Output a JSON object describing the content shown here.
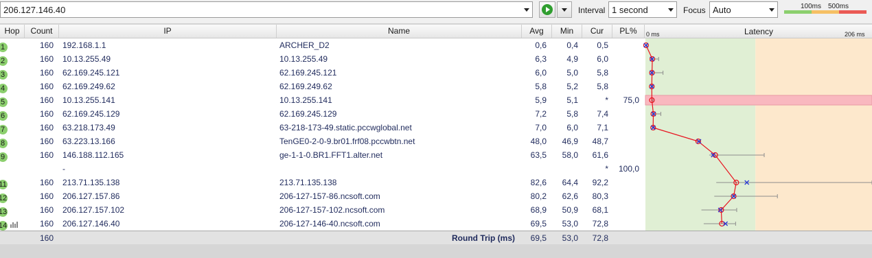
{
  "toolbar": {
    "target_value": "206.127.146.40",
    "interval_label": "Interval",
    "interval_value": "1 second",
    "focus_label": "Focus",
    "focus_value": "Auto",
    "scale_100": "100ms",
    "scale_500": "500ms"
  },
  "columns": {
    "hop": "Hop",
    "count": "Count",
    "ip": "IP",
    "name": "Name",
    "avg": "Avg",
    "min": "Min",
    "cur": "Cur",
    "pl": "PL%",
    "latency": "Latency",
    "latency_min": "0 ms",
    "latency_max": "206 ms"
  },
  "hops": [
    {
      "hop": "1",
      "count": "160",
      "ip": "192.168.1.1",
      "name": "ARCHER_D2",
      "avg": "0,6",
      "min": "0,4",
      "cur": "0,5",
      "pl": ""
    },
    {
      "hop": "2",
      "count": "160",
      "ip": "10.13.255.49",
      "name": "10.13.255.49",
      "avg": "6,3",
      "min": "4,9",
      "cur": "6,0",
      "pl": ""
    },
    {
      "hop": "3",
      "count": "160",
      "ip": "62.169.245.121",
      "name": "62.169.245.121",
      "avg": "6,0",
      "min": "5,0",
      "cur": "5,8",
      "pl": ""
    },
    {
      "hop": "4",
      "count": "160",
      "ip": "62.169.249.62",
      "name": "62.169.249.62",
      "avg": "5,8",
      "min": "5,2",
      "cur": "5,8",
      "pl": ""
    },
    {
      "hop": "5",
      "count": "160",
      "ip": "10.13.255.141",
      "name": "10.13.255.141",
      "avg": "5,9",
      "min": "5,1",
      "cur": "*",
      "pl": "75,0"
    },
    {
      "hop": "6",
      "count": "160",
      "ip": "62.169.245.129",
      "name": "62.169.245.129",
      "avg": "7,2",
      "min": "5,8",
      "cur": "7,4",
      "pl": ""
    },
    {
      "hop": "7",
      "count": "160",
      "ip": "63.218.173.49",
      "name": "63-218-173-49.static.pccwglobal.net",
      "avg": "7,0",
      "min": "6,0",
      "cur": "7,1",
      "pl": ""
    },
    {
      "hop": "8",
      "count": "160",
      "ip": "63.223.13.166",
      "name": "TenGE0-2-0-9.br01.frf08.pccwbtn.net",
      "avg": "48,0",
      "min": "46,9",
      "cur": "48,7",
      "pl": ""
    },
    {
      "hop": "9",
      "count": "160",
      "ip": "146.188.112.165",
      "name": "ge-1-1-0.BR1.FFT1.alter.net",
      "avg": "63,5",
      "min": "58,0",
      "cur": "61,6",
      "pl": ""
    },
    {
      "hop": "",
      "count": "",
      "ip": "-",
      "name": "",
      "avg": "",
      "min": "",
      "cur": "*",
      "pl": "100,0"
    },
    {
      "hop": "11",
      "count": "160",
      "ip": "213.71.135.138",
      "name": "213.71.135.138",
      "avg": "82,6",
      "min": "64,4",
      "cur": "92,2",
      "pl": ""
    },
    {
      "hop": "12",
      "count": "160",
      "ip": "206.127.157.86",
      "name": "206-127-157-86.ncsoft.com",
      "avg": "80,2",
      "min": "62,6",
      "cur": "80,3",
      "pl": ""
    },
    {
      "hop": "13",
      "count": "160",
      "ip": "206.127.157.102",
      "name": "206-127-157-102.ncsoft.com",
      "avg": "68,9",
      "min": "50,9",
      "cur": "68,1",
      "pl": ""
    },
    {
      "hop": "14",
      "count": "160",
      "ip": "206.127.146.40",
      "name": "206-127-146-40.ncsoft.com",
      "avg": "69,5",
      "min": "53,0",
      "cur": "72,8",
      "pl": ""
    }
  ],
  "footer": {
    "count": "160",
    "label": "Round Trip (ms)",
    "avg": "69,5",
    "min": "53,0",
    "cur": "72,8"
  },
  "latency_graph": {
    "max_ms": 206,
    "zone_boundaries_ms": [
      100,
      500
    ],
    "points": [
      {
        "avg": 0.6,
        "cur": 0.5,
        "min": 0.4,
        "max": 1.5
      },
      {
        "avg": 6.3,
        "cur": 6.0,
        "min": 4.9,
        "max": 12
      },
      {
        "avg": 6.0,
        "cur": 5.8,
        "min": 5.0,
        "max": 16
      },
      {
        "avg": 5.8,
        "cur": 5.8,
        "min": 5.2,
        "max": 7
      },
      {
        "avg": 5.9,
        "cur": null,
        "min": 5.1,
        "max": 7
      },
      {
        "avg": 7.2,
        "cur": 7.4,
        "min": 5.8,
        "max": 14
      },
      {
        "avg": 7.0,
        "cur": 7.1,
        "min": 6.0,
        "max": 8
      },
      {
        "avg": 48.0,
        "cur": 48.7,
        "min": 46.9,
        "max": 50
      },
      {
        "avg": 63.5,
        "cur": 61.6,
        "min": 58.0,
        "max": 108
      },
      null,
      {
        "avg": 82.6,
        "cur": 92.2,
        "min": 64.4,
        "max": 206
      },
      {
        "avg": 80.2,
        "cur": 80.3,
        "min": 62.6,
        "max": 120
      },
      {
        "avg": 68.9,
        "cur": 68.1,
        "min": 50.9,
        "max": 83
      },
      {
        "avg": 69.5,
        "cur": 72.8,
        "min": 53.0,
        "max": 82
      }
    ],
    "packet_loss_rows": [
      4
    ],
    "colors": {
      "good_zone": "#e0efd4",
      "warn_zone": "#fde8cc",
      "loss_bar": "#f9b8bf",
      "avg_line": "#e8131f",
      "cur_marker": "#2a3ad8",
      "range": "#8d8d8d"
    }
  }
}
